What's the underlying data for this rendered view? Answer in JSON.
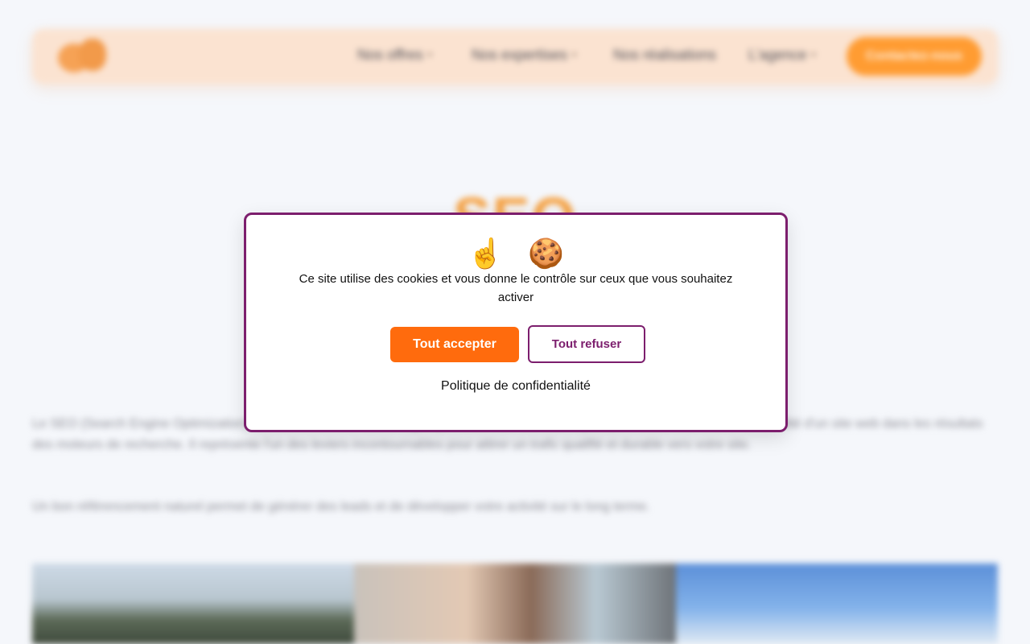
{
  "header": {
    "nav": [
      {
        "label": "Nos offres",
        "has_dropdown": true
      },
      {
        "label": "Nos expertises",
        "has_dropdown": true
      },
      {
        "label": "Nos réalisations",
        "has_dropdown": false
      },
      {
        "label": "L'agence",
        "has_dropdown": true
      }
    ],
    "cta_label": "Contactez-nous"
  },
  "hero": {
    "title": "SEO"
  },
  "content": {
    "paragraph_1": "Le SEO (Search Engine Optimization) ou référencement naturel regroupe l'ensemble des techniques permettant d'améliorer la visibilité d'un site web dans les résultats des moteurs de recherche. Il représente l'un des leviers incontournables pour attirer un trafic qualifié et durable vers votre site.",
    "paragraph_2": "Un bon référencement naturel permet de générer des leads et de développer votre activité sur le long terme."
  },
  "cookie_banner": {
    "emojis": [
      "☝️",
      "🍪"
    ],
    "message": "Ce site utilise des cookies et vous donne le contrôle sur ceux que vous souhaitez activer",
    "accept_label": "Tout accepter",
    "refuse_label": "Tout refuser",
    "policy_label": "Politique de confidentialité"
  },
  "colors": {
    "accent_orange": "#ff6b0d",
    "brand_purple": "#7c1e6d",
    "header_bg": "#fbe3d1",
    "page_bg": "#f5f7fb"
  }
}
